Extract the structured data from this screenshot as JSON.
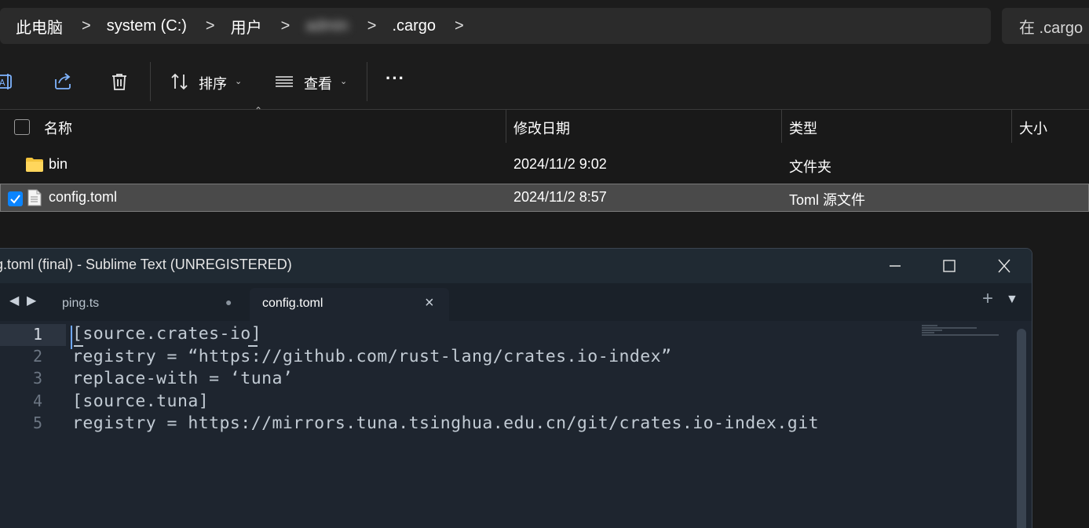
{
  "explorer": {
    "breadcrumb": {
      "this_pc": "此电脑",
      "drive": "system (C:)",
      "users": "用户",
      "username": "admin",
      "folder": ".cargo",
      "separator": ">"
    },
    "search_placeholder": "在 .cargo",
    "toolbar": {
      "sort_label": "排序",
      "view_label": "查看",
      "more_label": "···"
    },
    "columns": {
      "name": "名称",
      "modified": "修改日期",
      "type": "类型",
      "size": "大小"
    },
    "files": [
      {
        "name": "bin",
        "modified": "2024/11/2 9:02",
        "type": "文件夹",
        "icon": "folder-icon",
        "selected": false
      },
      {
        "name": "config.toml",
        "modified": "2024/11/2 8:57",
        "type": "Toml 源文件",
        "icon": "file-icon",
        "selected": true
      }
    ]
  },
  "sublime": {
    "title": "g.toml (final) - Sublime Text (UNREGISTERED)",
    "tabs": [
      {
        "label": "ping.ts",
        "active": false,
        "modified_dot": "●"
      },
      {
        "label": "config.toml",
        "active": true,
        "close": "×"
      }
    ],
    "new_tab": "+",
    "tab_menu": "▼",
    "gutter": [
      "1",
      "2",
      "3",
      "4",
      "5"
    ],
    "lines": [
      "[source.crates-io]",
      "registry = “https://github.com/rust-lang/crates.io-index”",
      "replace-with = ‘tuna’",
      "[source.tuna]",
      "registry = https://mirrors.tuna.tsinghua.edu.cn/git/crates.io-index.git"
    ]
  },
  "colors": {
    "accent": "#0a84ff",
    "folder": "#f3c33c",
    "cursor": "#6fa8ff"
  }
}
